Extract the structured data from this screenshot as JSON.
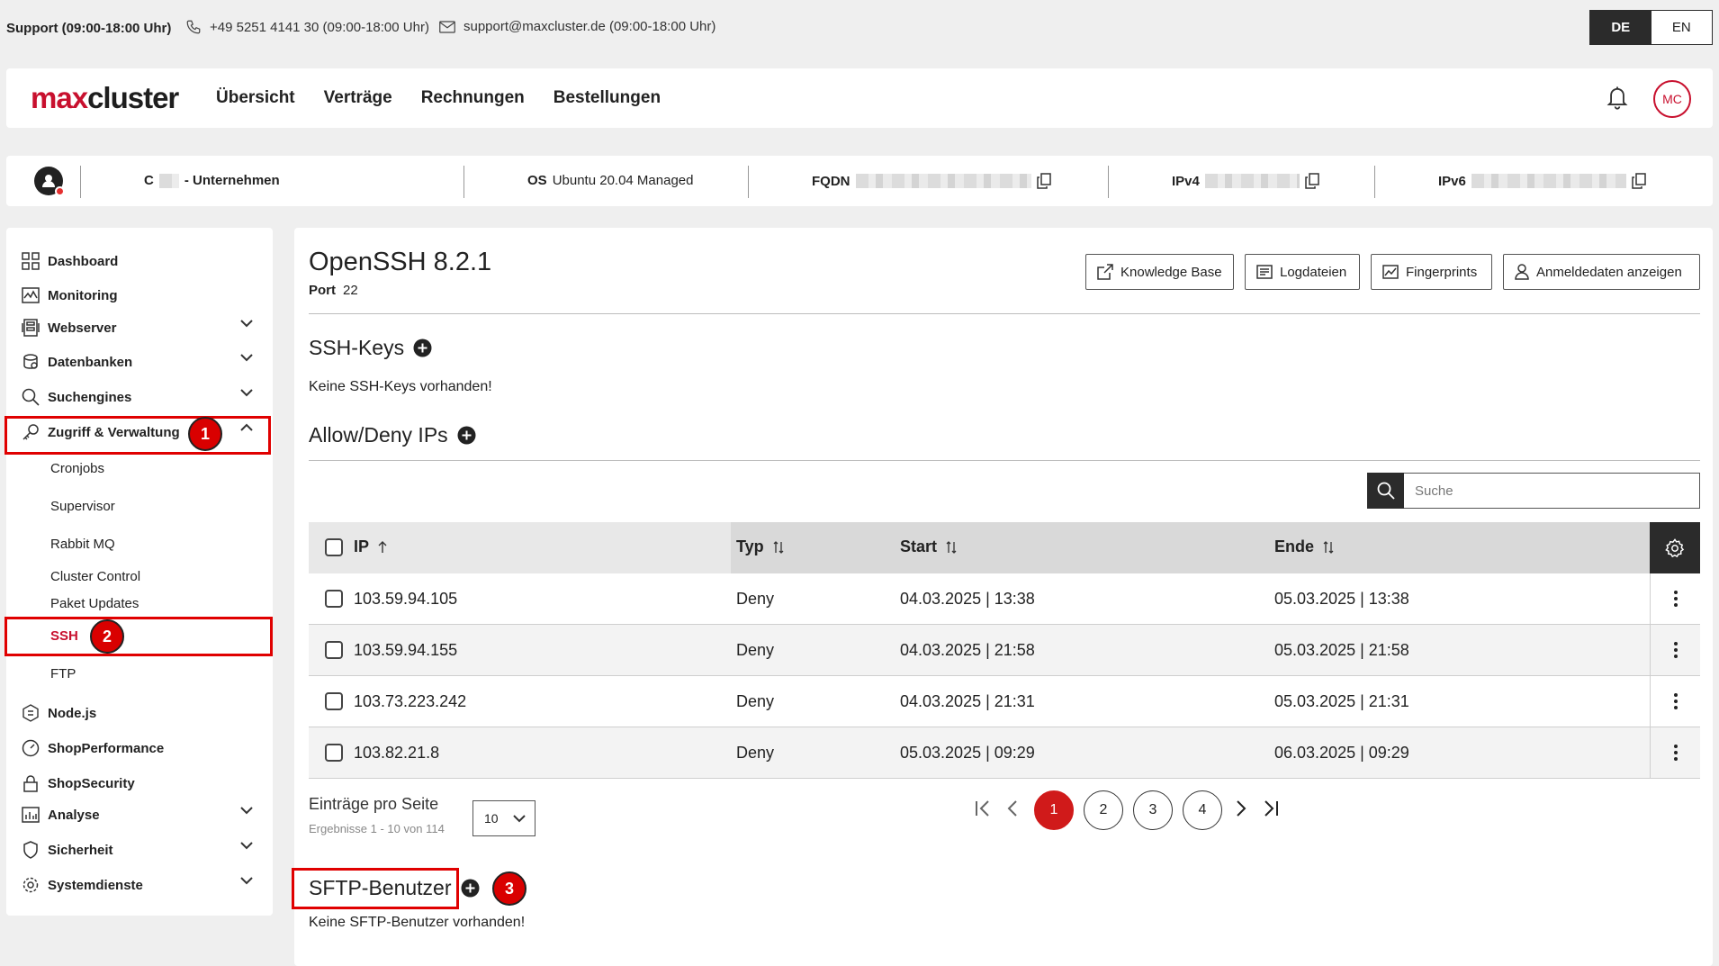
{
  "support": {
    "title": "Support (09:00-18:00 Uhr)",
    "phone": "+49 5251 4141 30 (09:00-18:00 Uhr)",
    "email": "support@maxcluster.de (09:00-18:00 Uhr)"
  },
  "languages": [
    {
      "code": "DE",
      "active": true
    },
    {
      "code": "EN",
      "active": false
    }
  ],
  "header": {
    "logo_max": "max",
    "logo_cluster": "cluster",
    "nav": [
      "Übersicht",
      "Verträge",
      "Rechnungen",
      "Bestellungen"
    ],
    "avatar_initials": "MC"
  },
  "infobar": {
    "customer_prefix": "C",
    "customer_suffix": "- Unternehmen",
    "os_label": "OS",
    "os_value": "Ubuntu 20.04 Managed",
    "fqdn_label": "FQDN",
    "ipv4_label": "IPv4",
    "ipv6_label": "IPv6"
  },
  "sidebar": {
    "items": [
      {
        "label": "Dashboard",
        "icon": "dashboard-icon",
        "expandable": false
      },
      {
        "label": "Monitoring",
        "icon": "monitoring-icon",
        "expandable": false
      },
      {
        "label": "Webserver",
        "icon": "webserver-icon",
        "expandable": true
      },
      {
        "label": "Datenbanken",
        "icon": "database-icon",
        "expandable": true
      },
      {
        "label": "Suchengines",
        "icon": "search-icon",
        "expandable": true
      },
      {
        "label": "Zugriff & Verwaltung",
        "icon": "key-icon",
        "expandable": true,
        "expanded": true
      },
      {
        "label": "Node.js",
        "icon": "nodejs-icon",
        "expandable": false
      },
      {
        "label": "ShopPerformance",
        "icon": "speedometer-icon",
        "expandable": false
      },
      {
        "label": "ShopSecurity",
        "icon": "lock-icon",
        "expandable": false
      },
      {
        "label": "Analyse",
        "icon": "chart-icon",
        "expandable": true
      },
      {
        "label": "Sicherheit",
        "icon": "shield-icon",
        "expandable": true
      },
      {
        "label": "Systemdienste",
        "icon": "settings-icon",
        "expandable": true
      }
    ],
    "subitems": [
      "Cronjobs",
      "Supervisor",
      "Rabbit MQ",
      "Cluster Control",
      "Paket Updates",
      "SSH",
      "FTP"
    ],
    "active_subitem": "SSH"
  },
  "markers": [
    "1",
    "2",
    "3"
  ],
  "main": {
    "title": "OpenSSH 8.2.1",
    "port_label": "Port",
    "port_value": "22",
    "buttons": [
      "Knowledge Base",
      "Logdateien",
      "Fingerprints",
      "Anmeldedaten anzeigen"
    ],
    "ssh_keys_title": "SSH-Keys",
    "ssh_keys_empty": "Keine SSH-Keys vorhanden!",
    "allow_deny_title": "Allow/Deny IPs",
    "search_placeholder": "Suche",
    "columns": [
      "IP",
      "Typ",
      "Start",
      "Ende"
    ],
    "rows": [
      {
        "ip": "103.59.94.105",
        "typ": "Deny",
        "start": "04.03.2025 | 13:38",
        "ende": "05.03.2025 | 13:38"
      },
      {
        "ip": "103.59.94.155",
        "typ": "Deny",
        "start": "04.03.2025 | 21:58",
        "ende": "05.03.2025 | 21:58"
      },
      {
        "ip": "103.73.223.242",
        "typ": "Deny",
        "start": "04.03.2025 | 21:31",
        "ende": "05.03.2025 | 21:31"
      },
      {
        "ip": "103.82.21.8",
        "typ": "Deny",
        "start": "05.03.2025 | 09:29",
        "ende": "06.03.2025 | 09:29"
      }
    ],
    "per_page_label": "Einträge pro Seite",
    "per_page_value": "10",
    "results_text": "Ergebnisse 1 - 10 von 114",
    "pages": [
      "1",
      "2",
      "3",
      "4"
    ],
    "current_page": "1",
    "sftp_title": "SFTP-Benutzer",
    "sftp_empty": "Keine SFTP-Benutzer vorhanden!"
  },
  "colors": {
    "brand_red": "#c8102e",
    "marker_red": "#d90000",
    "dark": "#2b2b2b"
  }
}
